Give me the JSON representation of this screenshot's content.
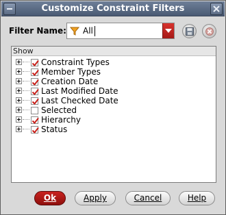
{
  "window": {
    "title": "Customize Constraint Filters"
  },
  "filter": {
    "label": "Filter Name:",
    "value": "All",
    "icon": "funnel-icon"
  },
  "toolbar": {
    "save_icon": "save-icon",
    "delete_icon": "delete-icon"
  },
  "tree": {
    "header": "Show",
    "items": [
      {
        "label": "Constraint Types",
        "checked": true
      },
      {
        "label": "Member Types",
        "checked": true
      },
      {
        "label": "Creation Date",
        "checked": true
      },
      {
        "label": "Last Modified Date",
        "checked": true
      },
      {
        "label": "Last Checked Date",
        "checked": true
      },
      {
        "label": "Selected",
        "checked": false
      },
      {
        "label": "Hierarchy",
        "checked": true
      },
      {
        "label": "Status",
        "checked": true
      }
    ]
  },
  "buttons": {
    "ok": "Ok",
    "apply": "Apply",
    "cancel": "Cancel",
    "help": "Help"
  },
  "colors": {
    "accent": "#b8201c",
    "check": "#c8201a",
    "titlebar": "#5a6a84"
  }
}
